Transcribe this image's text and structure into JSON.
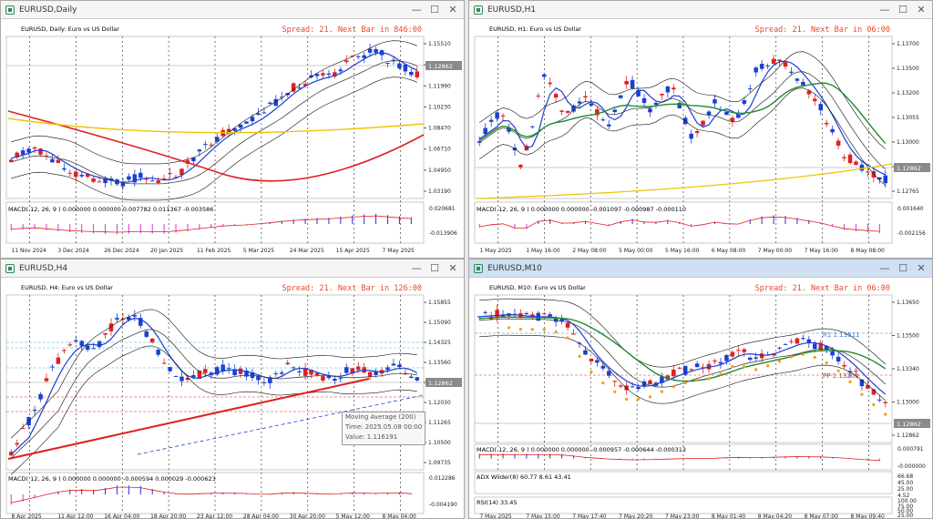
{
  "windows": [
    {
      "id": "daily",
      "title": "EURUSD,Daily",
      "symbol_label": "EURUSD, Daily: Euro vs US Dollar",
      "spread": "Spread: 21. Next Bar in 846:00",
      "price_levels": [
        "1.15510",
        "1.13750",
        "1.11990",
        "1.10230",
        "1.08470",
        "1.06710",
        "1.04950",
        "1.03190"
      ],
      "current_price": "1.12862",
      "macd_label": "MACD( 12, 26, 9 ) 0.000000 0.000000 0.007782 0.011367 -0.003586",
      "macd_levels": [
        "0.020681",
        "-0.013906"
      ],
      "time_labels": [
        "11 Nov 2024",
        "3 Dec 2024",
        "26 Dec 2024",
        "20 Jan 2025",
        "11 Feb 2025",
        "5 Mar 2025",
        "24 Mar 2025",
        "15 Apr 2025",
        "7 May 2025"
      ]
    },
    {
      "id": "h1",
      "title": "EURUSD,H1",
      "symbol_label": "EURUSD, H1: Euro vs US Dollar",
      "spread": "Spread: 21. Next Bar in 06:00",
      "price_levels": [
        "1.13700",
        "1.13500",
        "1.13200",
        "1.13055",
        "1.13000",
        "1.12910",
        "1.12765"
      ],
      "current_price": "1.12862",
      "macd_label": "MACD( 12, 26, 9 ) 0.000000 0.000000 -0.001097 -0.000987 -0.000110",
      "macd_levels": [
        "0.001640",
        "-0.002156"
      ],
      "time_labels": [
        "1 May 2025",
        "1 May 16:00",
        "2 May 08:00",
        "5 May 00:00",
        "5 May 16:00",
        "6 May 08:00",
        "7 May 00:00",
        "7 May 16:00",
        "8 May 08:00"
      ]
    },
    {
      "id": "h4",
      "title": "EURUSD,H4",
      "symbol_label": "EURUSD, H4: Euro vs US Dollar",
      "spread": "Spread: 21. Next Bar in 126:00",
      "price_levels": [
        "1.15855",
        "1.15090",
        "1.14325",
        "1.13560",
        "1.12862",
        "1.12030",
        "1.11265",
        "1.10500",
        "1.09735"
      ],
      "current_price": "1.12862",
      "macd_label": "MACD( 12, 26, 9 ) 0.000000 0.000000 -0.000594 0.000029 -0.000623",
      "macd_levels": [
        "0.012286",
        "-0.004190"
      ],
      "time_labels": [
        "8 Apr 2025",
        "11 Apr 12:00",
        "16 Apr 04:00",
        "18 Apr 20:00",
        "23 Apr 12:00",
        "28 Apr 04:00",
        "30 Apr 20:00",
        "5 May 12:00",
        "8 May 04:00"
      ],
      "tooltip": {
        "name": "Moving Average (200)",
        "time": "Time: 2025.05.08 00:00",
        "value": "Value: 1.116191"
      }
    },
    {
      "id": "m10",
      "title": "EURUSD,M10",
      "symbol_label": "EURUSD, M10: Euro vs US Dollar",
      "spread": "Spread: 21. Next Bar in 06:00",
      "price_levels": [
        "1.13650",
        "1.13500",
        "1.13340",
        "1.13000",
        "1.12862"
      ],
      "current_price": "1.12862",
      "r1_label": "R1 1.13511",
      "pp_label": "PP 1.13209",
      "macd_label": "MACD( 12, 26, 9 ) 0.000000 0.000000 -0.000957 -0.000644 -0.000313",
      "macd_levels": [
        "0.000791",
        "-0.000000"
      ],
      "adx_label": "ADX Wilder(8) 60.77 8.61 43.41",
      "adx_levels": [
        "66.68",
        "45.00",
        "25.00",
        "4.52"
      ],
      "rsi_label": "RSI(14) 33.45",
      "rsi_levels": [
        "100.00",
        "75.00",
        "50.00",
        "25.00"
      ],
      "time_labels": [
        "7 May 2025",
        "7 May 15:00",
        "7 May 17:40",
        "7 May 20:20",
        "7 May 23:00",
        "8 May 01:40",
        "8 May 04:20",
        "8 May 07:00",
        "8 May 09:40"
      ]
    }
  ],
  "colors": {
    "bull": "#1a3fd1",
    "bear": "#e02020",
    "ma200": "#e02020",
    "ma_gold": "#f2c300",
    "ma_green": "#1f8a2e",
    "spread": "#e8492c"
  }
}
